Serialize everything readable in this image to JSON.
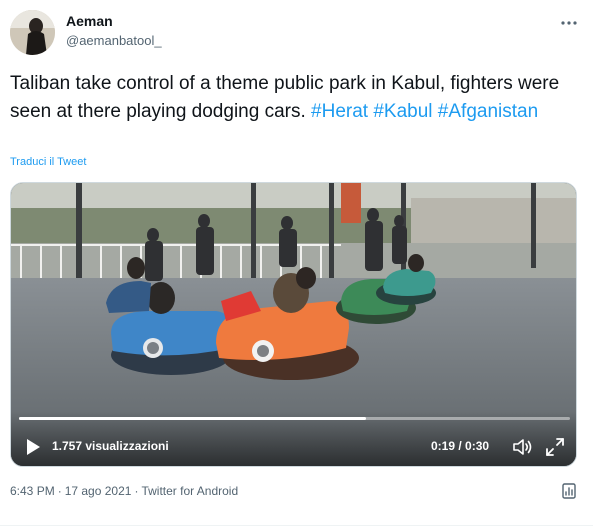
{
  "tweet": {
    "author": {
      "display_name": "Aeman",
      "handle": "@aemanbatool_"
    },
    "text_parts": [
      "Taliban take control of a theme public park in Kabul, fighters were seen at there playing dodging cars. ",
      "#Herat",
      " ",
      "#Kabul",
      " ",
      "#Afganistan"
    ],
    "translate_label": "Traduci il Tweet",
    "video": {
      "views": "1.757 visualizzazioni",
      "time": "0:19 / 0:30",
      "progress": 0.63
    },
    "meta": {
      "time": "6:43 PM",
      "separator": "·",
      "date": "17 ago 2021",
      "source": "Twitter for Android"
    }
  },
  "icons": {
    "more": "more-dots-icon",
    "play": "play-icon",
    "volume": "volume-icon",
    "fullscreen": "fullscreen-icon",
    "analytics": "analytics-icon"
  },
  "colors": {
    "accent": "#1d9bf0",
    "text": "#0f1419",
    "secondary": "#536471",
    "border": "#cfd9de"
  }
}
